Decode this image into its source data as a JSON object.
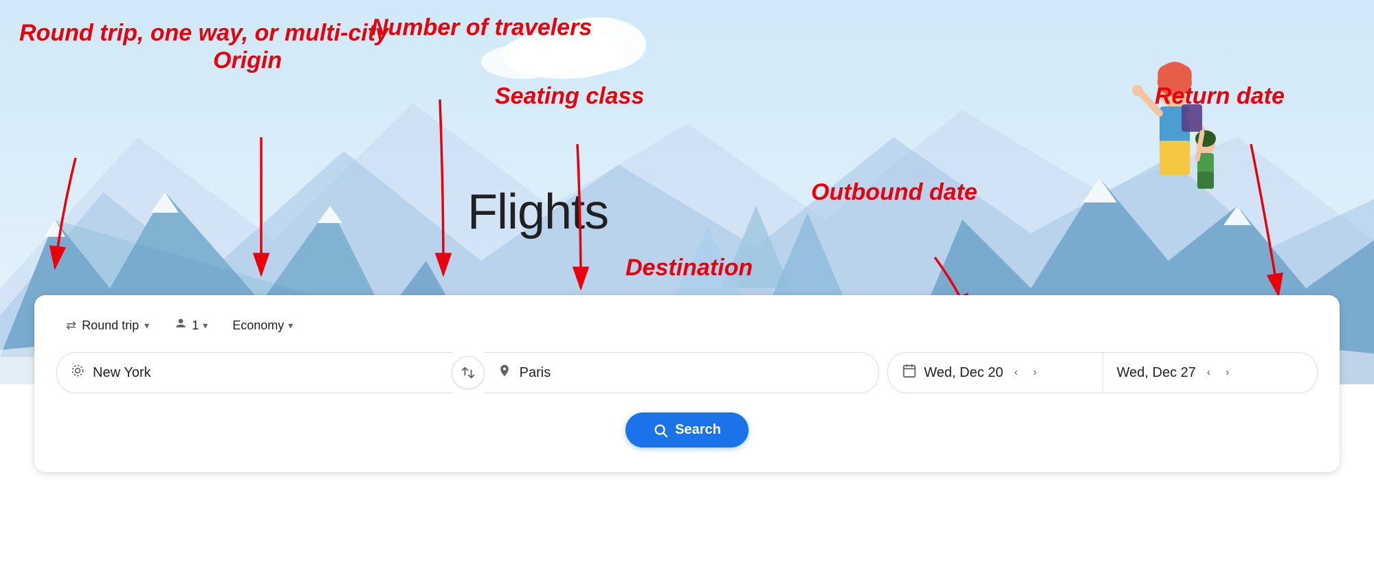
{
  "page": {
    "title": "Flights"
  },
  "annotations": {
    "round_trip_label": "Round trip,\none way,\nor multi-city",
    "origin_label": "Origin",
    "travelers_label": "Number of travelers",
    "seating_label": "Seating class",
    "destination_label": "Destination",
    "outbound_label": "Outbound date",
    "return_label": "Return date"
  },
  "search": {
    "trip_type": "Round trip",
    "travelers_count": "1",
    "seating_class": "Economy",
    "origin": "New York",
    "destination": "Paris",
    "outbound_date": "Wed, Dec 20",
    "return_date": "Wed, Dec 27",
    "search_button": "Search",
    "swap_icon": "⇄",
    "origin_icon": "○",
    "dest_icon": "📍",
    "date_icon": "📅",
    "round_trip_icon": "⇄",
    "traveler_icon": "👤",
    "chevron": "▾",
    "prev_icon": "‹",
    "next_icon": "›"
  }
}
